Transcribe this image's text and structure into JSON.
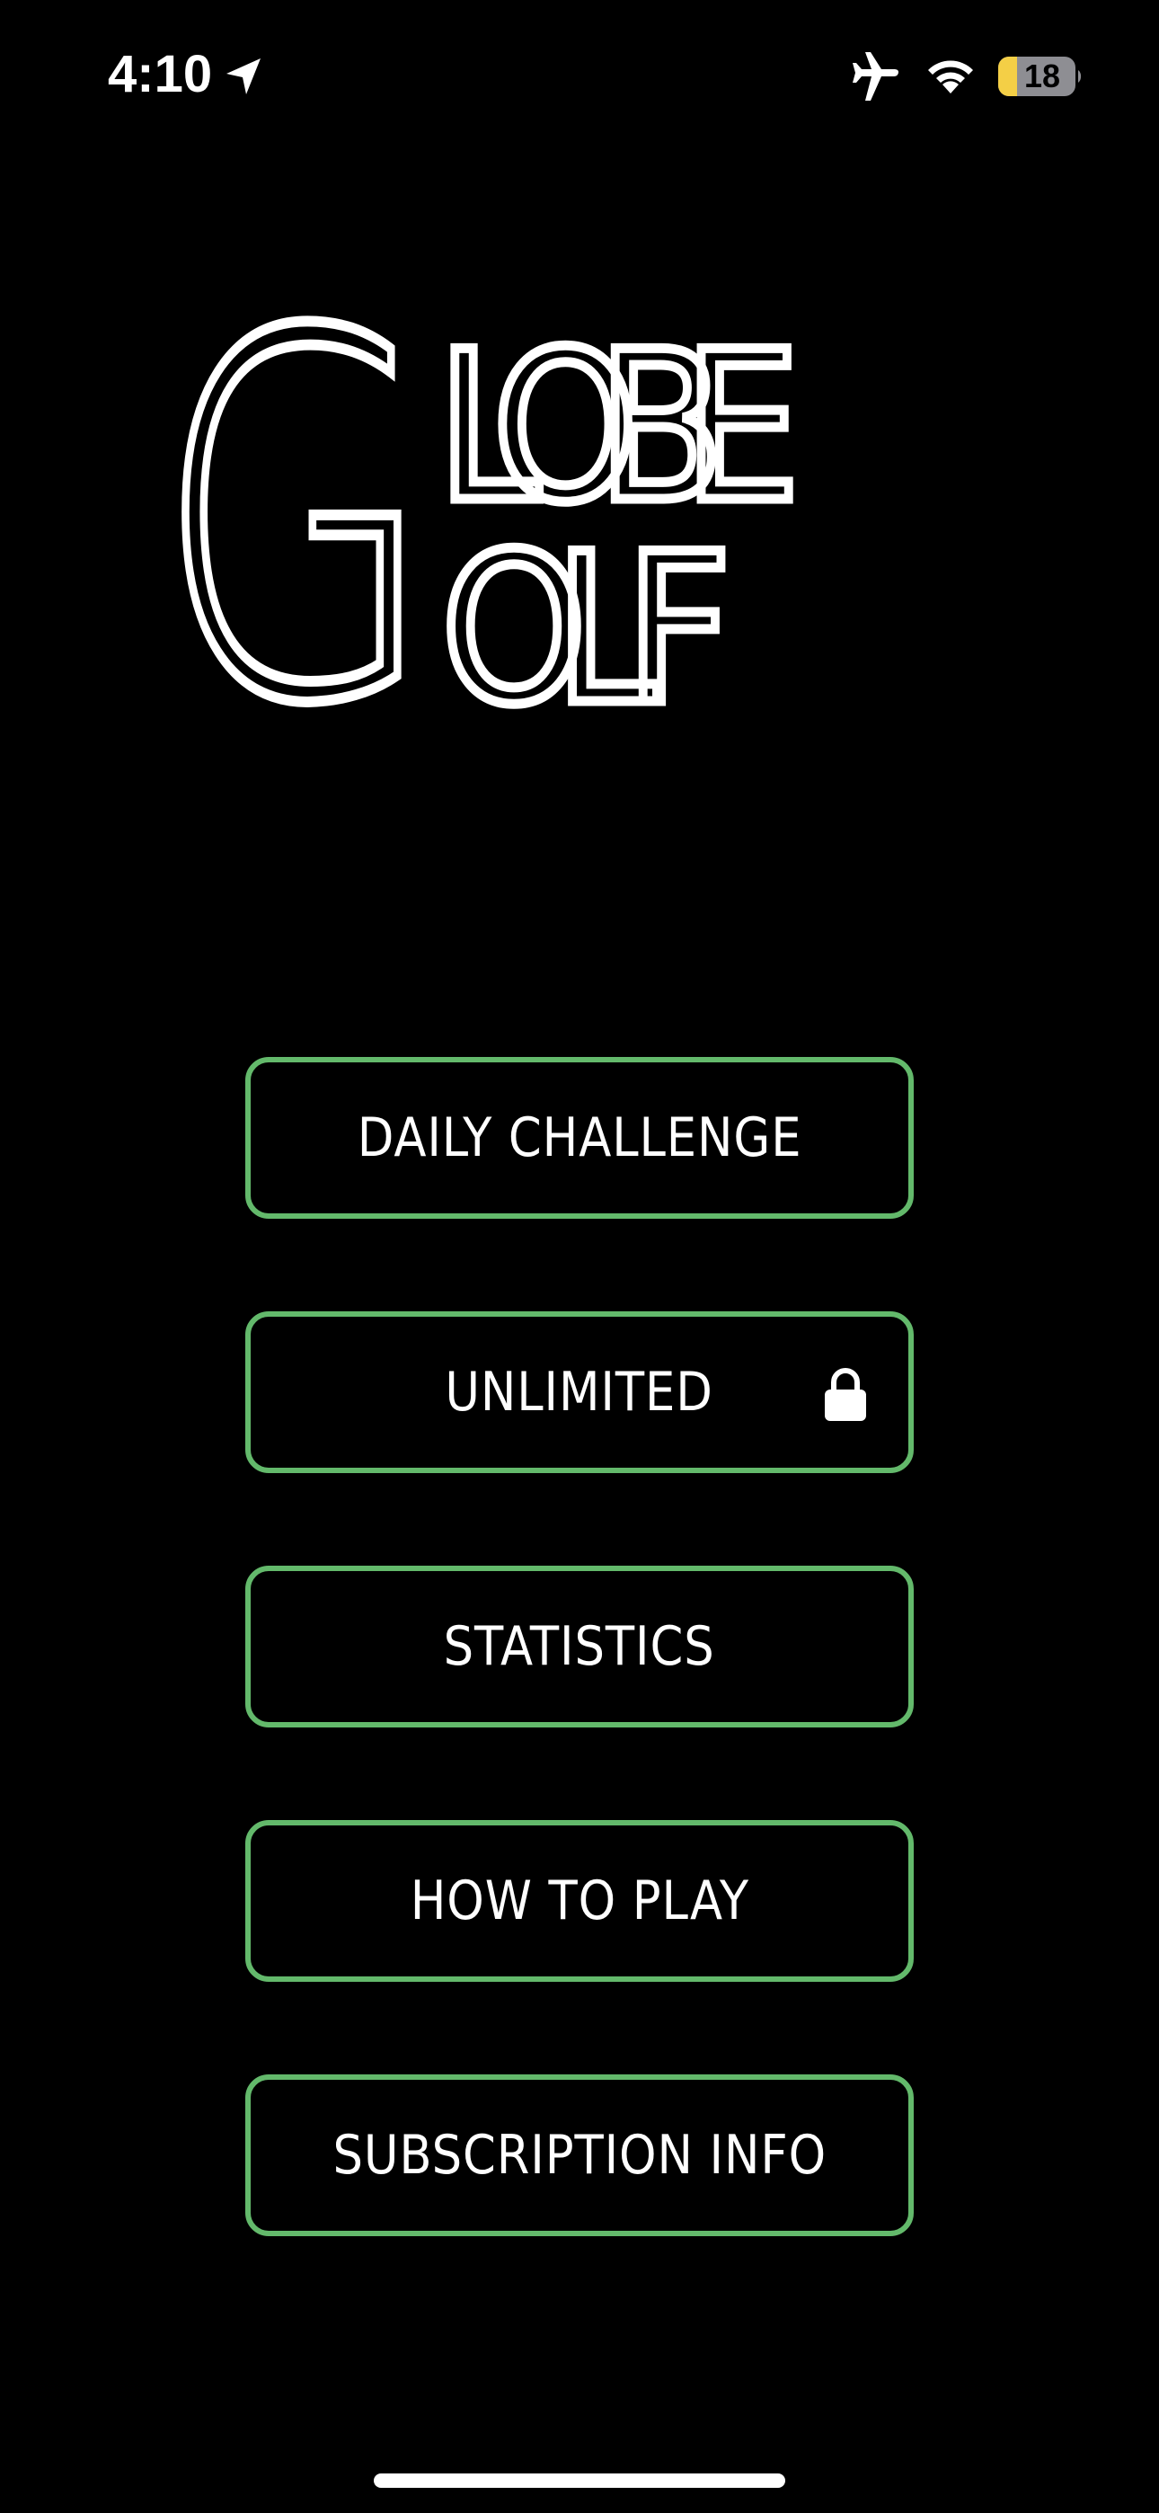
{
  "status_bar": {
    "time": "4:10",
    "battery_level": "18",
    "icons": [
      "location-arrow-icon",
      "airplane-mode-icon",
      "wifi-icon",
      "battery-icon"
    ],
    "battery_color": "#f4cf46"
  },
  "logo": {
    "big_letter": "G",
    "line1": "LOBE",
    "line2": "OLF"
  },
  "menu": {
    "items": [
      {
        "label": "DAILY CHALLENGE",
        "locked": false
      },
      {
        "label": "UNLIMITED",
        "locked": true,
        "icon": "lock-icon"
      },
      {
        "label": "STATISTICS",
        "locked": false
      },
      {
        "label": "HOW TO PLAY",
        "locked": false
      },
      {
        "label": "SUBSCRIPTION INFO",
        "locked": false
      }
    ]
  },
  "colors": {
    "background": "#000000",
    "button_border": "#63b96b",
    "text": "#ffffff"
  }
}
